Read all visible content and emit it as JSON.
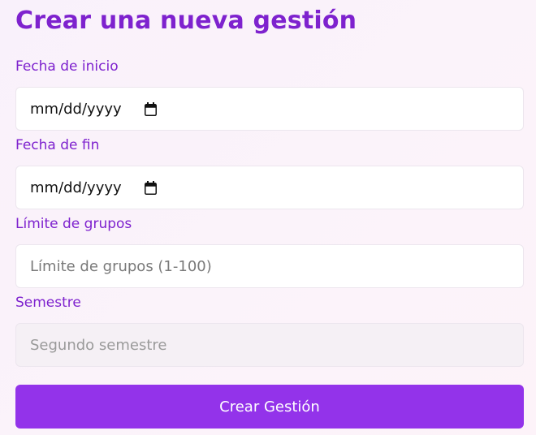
{
  "form": {
    "title": "Crear una nueva gestión",
    "start_date": {
      "label": "Fecha de inicio",
      "value": "mm/dd/yyyy",
      "icon": "calendar-icon"
    },
    "end_date": {
      "label": "Fecha de fin",
      "value": "mm/dd/yyyy",
      "icon": "calendar-icon"
    },
    "group_limit": {
      "label": "Límite de grupos",
      "placeholder": "Límite de grupos (1-100)"
    },
    "semester": {
      "label": "Semestre",
      "value": "Segundo semestre"
    },
    "submit_label": "Crear Gestión"
  },
  "colors": {
    "accent": "#7e22ce",
    "button": "#9333ea"
  }
}
